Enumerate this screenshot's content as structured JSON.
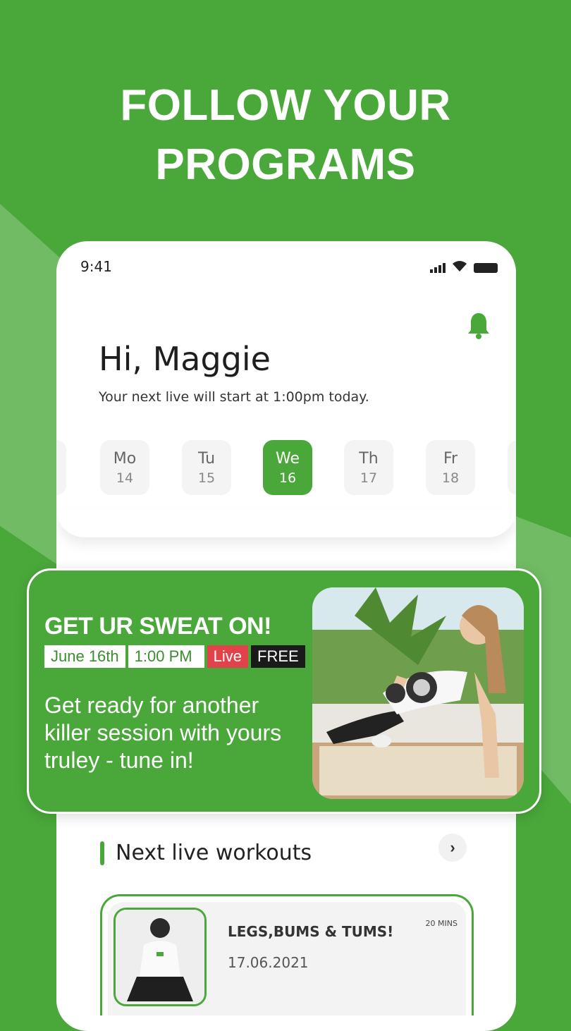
{
  "headline": {
    "line1": "FOLLOW YOUR",
    "line2": "PROGRAMS"
  },
  "status_bar": {
    "time": "9:41"
  },
  "greeting": {
    "title": "Hi, Maggie",
    "subtitle": "Your next live will start at 1:00pm today."
  },
  "week": {
    "days": [
      {
        "name": "Mo",
        "num": "14",
        "selected": false
      },
      {
        "name": "Tu",
        "num": "15",
        "selected": false
      },
      {
        "name": "We",
        "num": "16",
        "selected": true
      },
      {
        "name": "Th",
        "num": "17",
        "selected": false
      },
      {
        "name": "Fr",
        "num": "18",
        "selected": false
      }
    ]
  },
  "promo": {
    "title": "GET UR SWEAT ON!",
    "date": "June 16th",
    "time": "1:00 PM",
    "live": "Live",
    "price": "FREE",
    "body": "Get ready for another killer session with yours truley - tune in!"
  },
  "next_live": {
    "title": "Next live workouts",
    "arrow": "›"
  },
  "workout": {
    "name": "LEGS,BUMS & TUMS!",
    "date": "17.06.2021",
    "duration": "20 MINS"
  },
  "colors": {
    "brand_green": "#4aa83a",
    "live_red": "#e2434a",
    "free_black": "#1a1a1a"
  }
}
